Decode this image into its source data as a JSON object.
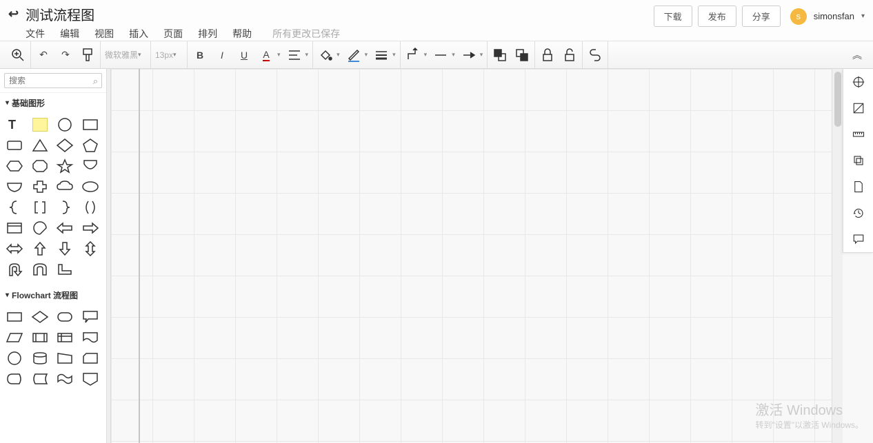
{
  "header": {
    "title": "测试流程图",
    "menu": [
      "文件",
      "编辑",
      "视图",
      "插入",
      "页面",
      "排列",
      "帮助"
    ],
    "save_status": "所有更改已保存",
    "buttons": {
      "download": "下载",
      "publish": "发布",
      "share": "分享"
    },
    "user": {
      "initial": "s",
      "name": "simonsfan"
    }
  },
  "toolbar": {
    "font_family": "微软雅黑",
    "font_size": "13px"
  },
  "sidebar": {
    "search_placeholder": "搜索",
    "categories": {
      "basic": "基础图形",
      "flowchart": "Flowchart 流程图"
    }
  },
  "watermark": {
    "line1": "激活 Windows",
    "line2": "转到\"设置\"以激活 Windows。"
  }
}
